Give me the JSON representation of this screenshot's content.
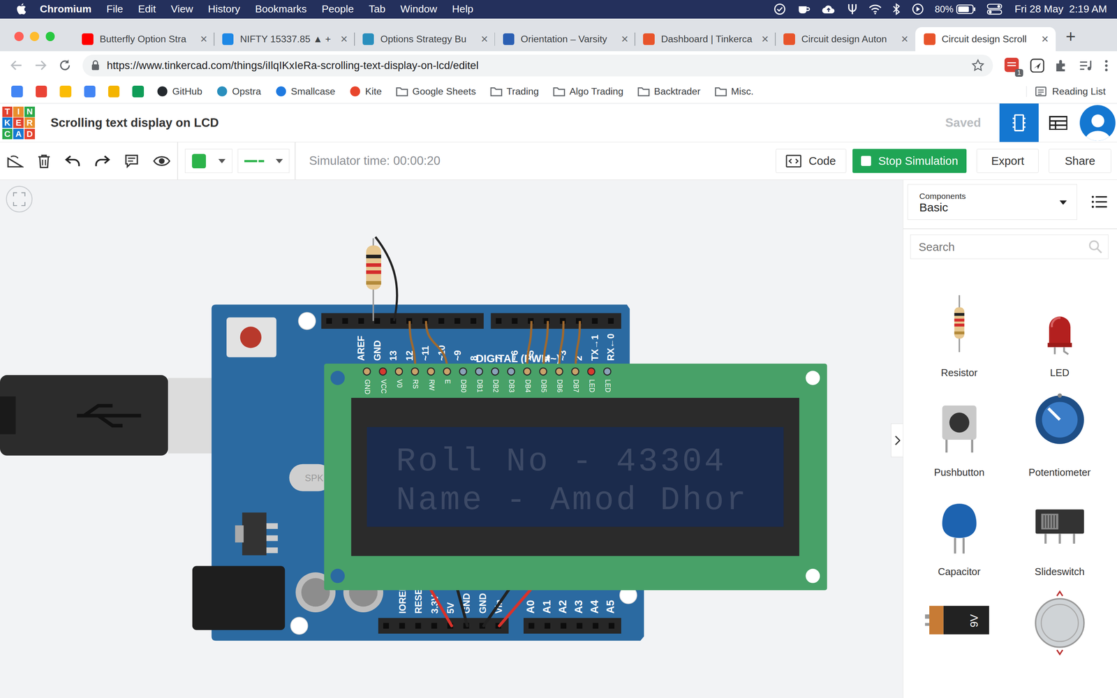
{
  "menu_bar": {
    "app": "Chromium",
    "items": [
      "File",
      "Edit",
      "View",
      "History",
      "Bookmarks",
      "People",
      "Tab",
      "Window",
      "Help"
    ],
    "battery": "80%",
    "clock": "Fri 28 May  2:19 AM"
  },
  "browser": {
    "tabs": [
      {
        "label": "Butterfly Option Stra",
        "selected": false,
        "color": "#ff0000"
      },
      {
        "label": "NIFTY 15337.85 ▲ +",
        "selected": false,
        "color": "#1e88e5"
      },
      {
        "label": "Options Strategy Bu",
        "selected": false,
        "color": "#2a8fbd"
      },
      {
        "label": "Orientation – Varsity",
        "selected": false,
        "color": "#2b5fb3"
      },
      {
        "label": "Dashboard | Tinkerca",
        "selected": false,
        "color": "#e8542b"
      },
      {
        "label": "Circuit design Auton",
        "selected": false,
        "color": "#e8542b"
      },
      {
        "label": "Circuit design Scroll",
        "selected": true,
        "color": "#e8542b"
      }
    ],
    "tab_close": "×",
    "new_tab": "+",
    "url": "https://www.tinkercad.com/things/iIlqIKxIeRa-scrolling-text-display-on-lcd/editel",
    "extension_badge": "1",
    "apps": [
      {
        "color": "#4285f4"
      },
      {
        "color": "#ea4335"
      },
      {
        "color": "#fbbc04"
      },
      {
        "color": "#4285f4"
      },
      {
        "color": "#f4b400"
      },
      {
        "color": "#0f9d58"
      }
    ],
    "bookmarks": [
      {
        "label": "GitHub",
        "kind": "site",
        "color": "#24292e"
      },
      {
        "label": "Opstra",
        "kind": "site",
        "color": "#2a8fbd"
      },
      {
        "label": "Smallcase",
        "kind": "site",
        "color": "#1f7ae0"
      },
      {
        "label": "Kite",
        "kind": "site",
        "color": "#e8452c"
      },
      {
        "label": "Google Sheets",
        "kind": "folder",
        "color": "#5f6368"
      },
      {
        "label": "Trading",
        "kind": "folder",
        "color": "#5f6368"
      },
      {
        "label": "Algo Trading",
        "kind": "folder",
        "color": "#5f6368"
      },
      {
        "label": "Backtrader",
        "kind": "folder",
        "color": "#5f6368"
      },
      {
        "label": "Misc.",
        "kind": "folder",
        "color": "#5f6368"
      }
    ],
    "reading_list": "Reading List"
  },
  "tinkercad": {
    "logo": [
      "T",
      "I",
      "N",
      "K",
      "E",
      "R",
      "C",
      "A",
      "D"
    ],
    "title": "Scrolling text display on LCD",
    "save_status": "Saved",
    "simulator_time": "Simulator time: 00:00:20",
    "buttons": {
      "code": "Code",
      "stop": "Stop Simulation",
      "export": "Export",
      "share": "Share"
    }
  },
  "components_panel": {
    "label": "Components",
    "category": "Basic",
    "search_placeholder": "Search",
    "items": [
      {
        "label": "Resistor",
        "kind": "resistor"
      },
      {
        "label": "LED",
        "kind": "led"
      },
      {
        "label": "Pushbutton",
        "kind": "pushbutton"
      },
      {
        "label": "Potentiometer",
        "kind": "potentiometer"
      },
      {
        "label": "Capacitor",
        "kind": "capacitor"
      },
      {
        "label": "Slideswitch",
        "kind": "slideswitch"
      },
      {
        "kind": "battery9v",
        "icon_text": "9V"
      },
      {
        "kind": "coincell"
      }
    ]
  },
  "circuit": {
    "arduino": {
      "digital_left": [
        "AREF",
        "GND",
        "13",
        "12",
        "~11",
        "~10",
        "~9",
        "8"
      ],
      "digital_right": [
        "7",
        "~6",
        "~5",
        "4",
        "~3",
        "2",
        "TX→1",
        "RX←0"
      ],
      "digital_label": "DIGITAL (PWM~)",
      "power": [
        "IOREF",
        "RESET",
        "3.3V",
        "5V",
        "GND",
        "GND",
        "Vin"
      ],
      "analog": [
        "A0",
        "A1",
        "A2",
        "A3",
        "A4",
        "A5"
      ],
      "crystal_label": "SPK"
    },
    "lcd": {
      "pins": [
        {
          "label": "GND",
          "color": "#c9a36b"
        },
        {
          "label": "VCC",
          "color": "#d63a2f"
        },
        {
          "label": "V0",
          "color": "#c9a36b"
        },
        {
          "label": "RS",
          "color": "#c9a36b"
        },
        {
          "label": "RW",
          "color": "#c9a36b"
        },
        {
          "label": "E",
          "color": "#c9a36b"
        },
        {
          "label": "DB0",
          "color": "#8aa2b8"
        },
        {
          "label": "DB1",
          "color": "#8aa2b8"
        },
        {
          "label": "DB2",
          "color": "#8aa2b8"
        },
        {
          "label": "DB3",
          "color": "#8aa2b8"
        },
        {
          "label": "DB4",
          "color": "#c9a36b"
        },
        {
          "label": "DB5",
          "color": "#c9a36b"
        },
        {
          "label": "DB6",
          "color": "#c9a36b"
        },
        {
          "label": "DB7",
          "color": "#c9a36b"
        },
        {
          "label": "LED",
          "color": "#d63a2f"
        },
        {
          "label": "LED",
          "color": "#8aa2b8"
        }
      ],
      "lines": [
        "Roll No - 43304",
        "Name - Amod Dhor"
      ]
    }
  }
}
